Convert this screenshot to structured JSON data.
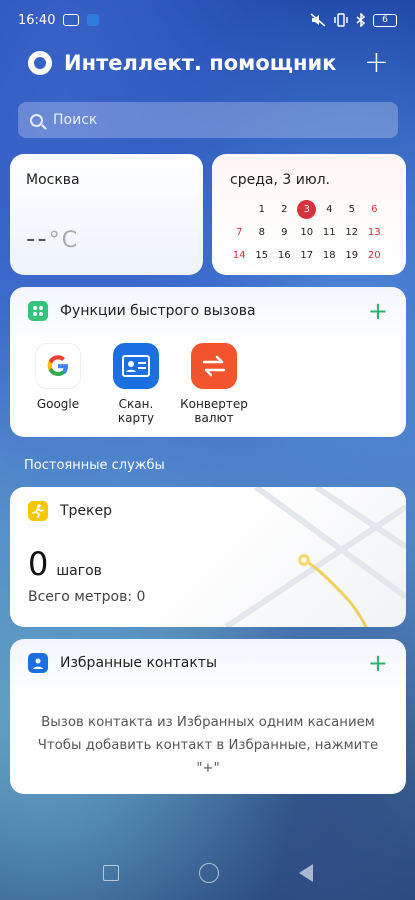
{
  "status_bar": {
    "time": "16:40",
    "battery": "6"
  },
  "header": {
    "title": "Интеллект. помощник",
    "add_label": "+"
  },
  "search": {
    "placeholder": "Поиск"
  },
  "weather": {
    "city": "Москва",
    "temp": "--",
    "unit": "°C"
  },
  "calendar": {
    "date": "среда, 3 июл.",
    "weeks": [
      [
        "",
        "1",
        "2",
        "3",
        "4",
        "5",
        "6"
      ],
      [
        "7",
        "8",
        "9",
        "10",
        "11",
        "12",
        "13"
      ],
      [
        "14",
        "15",
        "16",
        "17",
        "18",
        "19",
        "20"
      ]
    ],
    "today": "3"
  },
  "quick_functions": {
    "title": "Функции быстрого вызова",
    "apps": [
      {
        "label": "Google",
        "icon": "google-icon"
      },
      {
        "label": "Скан. карту",
        "icon": "card-scan-icon"
      },
      {
        "label": "Конвертер валют",
        "icon": "currency-converter-icon"
      }
    ]
  },
  "permanent_services": {
    "title": "Постоянные службы"
  },
  "tracker": {
    "title": "Трекер",
    "steps": "0",
    "steps_label": "шагов",
    "meters": "Всего метров: 0"
  },
  "favorites": {
    "title": "Избранные контакты",
    "line1": "Вызов контакта из Избранных одним касанием",
    "line2": "Чтобы добавить контакт в Избранные, нажмите",
    "line3": "\"+\""
  },
  "colors": {
    "accent_green": "#29b36a",
    "today_red": "#d8323f",
    "scan_blue": "#1b6fe0",
    "converter_orange": "#f2542d"
  }
}
